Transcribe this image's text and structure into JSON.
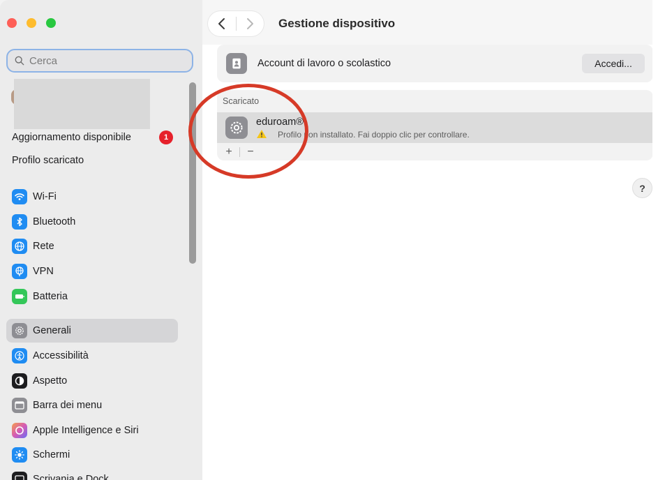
{
  "window": {
    "colors": {
      "accent": "#0a84ff",
      "annotation": "#d63a27",
      "badge": "#e6212b"
    }
  },
  "sidebar": {
    "search_placeholder": "Cerca",
    "update_label": "Aggiornamento disponibile",
    "update_badge": "1",
    "profile_downloaded": "Profilo scaricato",
    "items": [
      {
        "label": "Wi-Fi",
        "icon": "wifi-icon",
        "color": "#1f8cf2"
      },
      {
        "label": "Bluetooth",
        "icon": "bluetooth-icon",
        "color": "#1f8cf2"
      },
      {
        "label": "Rete",
        "icon": "globe-icon",
        "color": "#1f8cf2"
      },
      {
        "label": "VPN",
        "icon": "vpn-globe-icon",
        "color": "#1f8cf2"
      },
      {
        "label": "Batteria",
        "icon": "battery-icon",
        "color": "#34c759"
      },
      {
        "label": "Generali",
        "icon": "gear-icon",
        "color": "#8e8e93",
        "selected": true
      },
      {
        "label": "Accessibilità",
        "icon": "accessibility-icon",
        "color": "#1f8cf2"
      },
      {
        "label": "Aspetto",
        "icon": "appearance-icon",
        "color": "#1d1d1f"
      },
      {
        "label": "Barra dei menu",
        "icon": "menubar-icon",
        "color": "#8e8e93"
      },
      {
        "label": "Apple Intelligence e Siri",
        "icon": "siri-icon",
        "color": "#d65bb4"
      },
      {
        "label": "Schermi",
        "icon": "sun-icon",
        "color": "#1f8cf2"
      },
      {
        "label": "Scrivania e Dock",
        "icon": "dock-icon",
        "color": "#1d1d1f"
      }
    ]
  },
  "main": {
    "title": "Gestione dispositivo",
    "account": {
      "label": "Account di lavoro o scolastico",
      "button": "Accedi..."
    },
    "section_label": "Scaricato",
    "profile": {
      "name": "eduroam®",
      "status": "Profilo non installato. Fai doppio clic per controllare."
    },
    "add_label": "+",
    "remove_label": "−",
    "help_label": "?"
  }
}
